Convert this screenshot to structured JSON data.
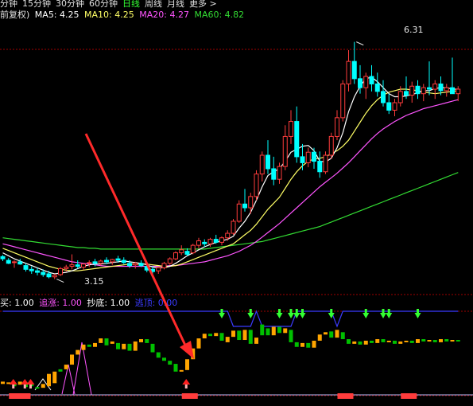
{
  "timeframes": [
    {
      "label": "分钟",
      "color": "#e0e0e0"
    },
    {
      "label": "15分钟",
      "color": "#e0e0e0"
    },
    {
      "label": "30分钟",
      "color": "#e0e0e0"
    },
    {
      "label": "60分钟",
      "color": "#e0e0e0"
    },
    {
      "label": "日线",
      "color": "#33ff33"
    },
    {
      "label": "周线",
      "color": "#e0e0e0"
    },
    {
      "label": "月线",
      "color": "#e0e0e0"
    },
    {
      "label": "更多 >",
      "color": "#e0e0e0"
    }
  ],
  "main_legend": {
    "prefix": "前复权)",
    "ma5": "MA5: 4.25",
    "ma10": "MA10: 4.25",
    "ma20": "MA20: 4.27",
    "ma60": "MA60: 4.82"
  },
  "colors": {
    "up": "#ff3c3c",
    "down": "#00ffff",
    "ma5": "#ffffff",
    "ma10": "#ffff66",
    "ma20": "#ff55ff",
    "ma60": "#33dd33",
    "indicator_line": "#3b3bff",
    "orange": "#ffa500",
    "green": "#00c000",
    "arrow_green": "#33ff33",
    "arrow_red": "#ff2020",
    "pink": "#ffb0b0",
    "gridline": "#a00000",
    "annotation_arrow": "#ff2a2a"
  },
  "sub_legend": {
    "buy": "买: 1.00",
    "chase": "追涨: 1.00",
    "bottom": "抄底: 1.00",
    "escape": "逃顶: 0.00"
  },
  "high_label": "6.31",
  "low_label": "3.15",
  "chart_data": {
    "type": "candlestick",
    "ohlc": [
      [
        3.45,
        3.47,
        3.39,
        3.42
      ],
      [
        3.4,
        3.43,
        3.35,
        3.36
      ],
      [
        3.37,
        3.4,
        3.3,
        3.38
      ],
      [
        3.38,
        3.42,
        3.34,
        3.35
      ],
      [
        3.33,
        3.36,
        3.25,
        3.28
      ],
      [
        3.28,
        3.32,
        3.22,
        3.26
      ],
      [
        3.26,
        3.3,
        3.2,
        3.24
      ],
      [
        3.24,
        3.28,
        3.18,
        3.21
      ],
      [
        3.22,
        3.26,
        3.16,
        3.18
      ],
      [
        3.18,
        3.22,
        3.15,
        3.2
      ],
      [
        3.21,
        3.31,
        3.19,
        3.29
      ],
      [
        3.29,
        3.34,
        3.25,
        3.31
      ],
      [
        3.32,
        3.48,
        3.28,
        3.34
      ],
      [
        3.34,
        3.4,
        3.29,
        3.32
      ],
      [
        3.31,
        3.36,
        3.27,
        3.35
      ],
      [
        3.36,
        3.4,
        3.31,
        3.37
      ],
      [
        3.38,
        3.42,
        3.32,
        3.36
      ],
      [
        3.36,
        3.41,
        3.33,
        3.39
      ],
      [
        3.4,
        3.44,
        3.35,
        3.38
      ],
      [
        3.38,
        3.42,
        3.34,
        3.41
      ],
      [
        3.42,
        3.46,
        3.37,
        3.4
      ],
      [
        3.4,
        3.44,
        3.35,
        3.37
      ],
      [
        3.36,
        3.4,
        3.3,
        3.33
      ],
      [
        3.34,
        3.38,
        3.29,
        3.36
      ],
      [
        3.36,
        3.4,
        3.31,
        3.33
      ],
      [
        3.32,
        3.36,
        3.24,
        3.27
      ],
      [
        3.28,
        3.32,
        3.22,
        3.25
      ],
      [
        3.26,
        3.31,
        3.22,
        3.3
      ],
      [
        3.3,
        3.38,
        3.28,
        3.36
      ],
      [
        3.36,
        3.44,
        3.34,
        3.42
      ],
      [
        3.42,
        3.52,
        3.4,
        3.5
      ],
      [
        3.5,
        3.6,
        3.47,
        3.54
      ],
      [
        3.52,
        3.56,
        3.46,
        3.48
      ],
      [
        3.5,
        3.62,
        3.48,
        3.6
      ],
      [
        3.6,
        3.7,
        3.56,
        3.66
      ],
      [
        3.64,
        3.68,
        3.58,
        3.62
      ],
      [
        3.62,
        3.7,
        3.58,
        3.68
      ],
      [
        3.68,
        3.74,
        3.62,
        3.64
      ],
      [
        3.64,
        3.72,
        3.6,
        3.7
      ],
      [
        3.7,
        3.8,
        3.66,
        3.76
      ],
      [
        3.76,
        3.95,
        3.74,
        3.92
      ],
      [
        3.92,
        4.2,
        3.9,
        4.15
      ],
      [
        4.15,
        4.35,
        4.05,
        4.1
      ],
      [
        4.1,
        4.3,
        4.02,
        4.25
      ],
      [
        4.25,
        4.6,
        4.2,
        4.55
      ],
      [
        4.55,
        4.85,
        4.45,
        4.8
      ],
      [
        4.8,
        5.0,
        4.55,
        4.62
      ],
      [
        4.62,
        4.78,
        4.4,
        4.48
      ],
      [
        4.48,
        4.7,
        4.42,
        4.65
      ],
      [
        4.65,
        5.2,
        4.6,
        5.05
      ],
      [
        5.05,
        5.4,
        4.95,
        5.25
      ],
      [
        5.25,
        5.45,
        4.7,
        4.78
      ],
      [
        4.78,
        4.95,
        4.6,
        4.7
      ],
      [
        4.7,
        4.9,
        4.64,
        4.84
      ],
      [
        4.84,
        4.9,
        4.62,
        4.72
      ],
      [
        4.72,
        4.85,
        4.5,
        4.58
      ],
      [
        4.58,
        4.85,
        4.55,
        4.8
      ],
      [
        4.8,
        5.1,
        4.75,
        5.05
      ],
      [
        5.05,
        5.4,
        5.0,
        5.3
      ],
      [
        5.3,
        5.8,
        5.25,
        5.75
      ],
      [
        5.75,
        6.2,
        5.65,
        6.05
      ],
      [
        6.05,
        6.31,
        5.75,
        5.82
      ],
      [
        5.82,
        6.0,
        5.62,
        5.7
      ],
      [
        5.7,
        5.9,
        5.55,
        5.85
      ],
      [
        5.85,
        6.0,
        5.65,
        5.75
      ],
      [
        5.75,
        5.9,
        5.58,
        5.65
      ],
      [
        5.65,
        5.8,
        5.45,
        5.5
      ],
      [
        5.5,
        5.62,
        5.35,
        5.4
      ],
      [
        5.4,
        5.55,
        5.32,
        5.5
      ],
      [
        5.5,
        5.72,
        5.45,
        5.65
      ],
      [
        5.65,
        5.85,
        5.55,
        5.6
      ],
      [
        5.6,
        5.78,
        5.5,
        5.72
      ],
      [
        5.72,
        5.8,
        5.55,
        5.62
      ],
      [
        5.62,
        5.75,
        5.52,
        5.7
      ],
      [
        5.7,
        6.05,
        5.6,
        5.68
      ],
      [
        5.68,
        5.8,
        5.55,
        5.75
      ],
      [
        5.75,
        5.85,
        5.6,
        5.66
      ],
      [
        5.66,
        5.75,
        5.58,
        5.7
      ],
      [
        5.7,
        6.1,
        5.62,
        5.62
      ],
      [
        5.62,
        5.72,
        5.52,
        5.68
      ]
    ],
    "ma5": [
      3.5,
      3.46,
      3.42,
      3.39,
      3.36,
      3.33,
      3.3,
      3.27,
      3.24,
      3.22,
      3.23,
      3.24,
      3.26,
      3.29,
      3.32,
      3.34,
      3.35,
      3.35,
      3.36,
      3.37,
      3.38,
      3.39,
      3.38,
      3.37,
      3.36,
      3.34,
      3.31,
      3.3,
      3.3,
      3.32,
      3.36,
      3.41,
      3.46,
      3.5,
      3.54,
      3.58,
      3.61,
      3.64,
      3.66,
      3.68,
      3.72,
      3.83,
      3.92,
      4.04,
      4.2,
      4.38,
      4.53,
      4.58,
      4.62,
      4.72,
      4.84,
      4.88,
      4.92,
      4.93,
      4.86,
      4.72,
      4.71,
      4.76,
      4.9,
      5.1,
      5.38,
      5.58,
      5.72,
      5.82,
      5.84,
      5.78,
      5.7,
      5.62,
      5.58,
      5.58,
      5.59,
      5.61,
      5.63,
      5.66,
      5.66,
      5.69,
      5.7,
      5.7,
      5.68,
      5.68
    ],
    "ma10": [
      3.56,
      3.53,
      3.5,
      3.47,
      3.44,
      3.41,
      3.38,
      3.35,
      3.32,
      3.3,
      3.28,
      3.27,
      3.26,
      3.26,
      3.27,
      3.28,
      3.29,
      3.3,
      3.31,
      3.32,
      3.33,
      3.34,
      3.35,
      3.35,
      3.35,
      3.35,
      3.34,
      3.33,
      3.32,
      3.32,
      3.33,
      3.35,
      3.38,
      3.41,
      3.44,
      3.47,
      3.5,
      3.53,
      3.56,
      3.59,
      3.62,
      3.68,
      3.74,
      3.8,
      3.88,
      3.98,
      4.08,
      4.16,
      4.24,
      4.36,
      4.48,
      4.58,
      4.66,
      4.72,
      4.75,
      4.76,
      4.78,
      4.82,
      4.86,
      4.92,
      5.0,
      5.12,
      5.24,
      5.36,
      5.46,
      5.54,
      5.6,
      5.64,
      5.66,
      5.68,
      5.68,
      5.67,
      5.66,
      5.64,
      5.63,
      5.62,
      5.63,
      5.64,
      5.65,
      5.66
    ],
    "ma20": [
      3.62,
      3.6,
      3.58,
      3.56,
      3.54,
      3.52,
      3.5,
      3.48,
      3.46,
      3.44,
      3.42,
      3.4,
      3.38,
      3.37,
      3.36,
      3.35,
      3.34,
      3.33,
      3.32,
      3.32,
      3.32,
      3.32,
      3.32,
      3.32,
      3.32,
      3.32,
      3.32,
      3.32,
      3.32,
      3.33,
      3.33,
      3.34,
      3.35,
      3.36,
      3.37,
      3.38,
      3.4,
      3.42,
      3.44,
      3.46,
      3.49,
      3.52,
      3.56,
      3.6,
      3.65,
      3.71,
      3.77,
      3.83,
      3.89,
      3.96,
      4.03,
      4.1,
      4.17,
      4.24,
      4.31,
      4.38,
      4.44,
      4.5,
      4.56,
      4.63,
      4.7,
      4.78,
      4.86,
      4.94,
      5.02,
      5.09,
      5.15,
      5.2,
      5.25,
      5.29,
      5.33,
      5.36,
      5.39,
      5.42,
      5.44,
      5.46,
      5.48,
      5.5,
      5.52,
      5.54
    ],
    "ma60": [
      3.7,
      3.69,
      3.68,
      3.67,
      3.66,
      3.65,
      3.64,
      3.63,
      3.62,
      3.61,
      3.6,
      3.59,
      3.58,
      3.57,
      3.57,
      3.56,
      3.56,
      3.55,
      3.55,
      3.55,
      3.55,
      3.55,
      3.55,
      3.55,
      3.55,
      3.55,
      3.55,
      3.55,
      3.55,
      3.55,
      3.55,
      3.55,
      3.55,
      3.55,
      3.55,
      3.55,
      3.56,
      3.57,
      3.58,
      3.59,
      3.6,
      3.61,
      3.62,
      3.63,
      3.64,
      3.65,
      3.67,
      3.69,
      3.71,
      3.73,
      3.75,
      3.77,
      3.79,
      3.81,
      3.83,
      3.85,
      3.88,
      3.91,
      3.94,
      3.97,
      4.0,
      4.03,
      4.06,
      4.09,
      4.12,
      4.15,
      4.18,
      4.21,
      4.24,
      4.27,
      4.3,
      4.33,
      4.36,
      4.39,
      4.42,
      4.45,
      4.48,
      4.51,
      4.54,
      4.57
    ],
    "ylim": [
      3.05,
      6.55
    ],
    "indicator_ylim": [
      0,
      10
    ],
    "indicator": [
      [
        1.0,
        1.3,
        "o"
      ],
      [
        1.0,
        1.2,
        "o"
      ],
      [
        0.7,
        1.1,
        "g"
      ],
      [
        0.9,
        1.3,
        "o"
      ],
      [
        1.2,
        0.6,
        "g"
      ],
      [
        1.0,
        0.7,
        "g"
      ],
      [
        0.6,
        0.4,
        "g"
      ],
      [
        0.5,
        1.0,
        "o"
      ],
      [
        0.7,
        2.3,
        "o"
      ],
      [
        1.1,
        2.6,
        "o"
      ],
      [
        2.6,
        2.9,
        "g"
      ],
      [
        2.9,
        3.5,
        "o"
      ],
      [
        3.5,
        4.8,
        "o"
      ],
      [
        4.8,
        5.4,
        "o"
      ],
      [
        5.4,
        6.1,
        "o"
      ],
      [
        6.1,
        5.8,
        "g"
      ],
      [
        5.8,
        6.3,
        "o"
      ],
      [
        6.3,
        6.9,
        "o"
      ],
      [
        6.9,
        6.0,
        "g"
      ],
      [
        6.2,
        6.5,
        "o"
      ],
      [
        6.3,
        5.5,
        "g"
      ],
      [
        5.5,
        6.2,
        "o"
      ],
      [
        6.2,
        5.3,
        "g"
      ],
      [
        5.3,
        6.5,
        "o"
      ],
      [
        6.4,
        6.8,
        "o"
      ],
      [
        6.8,
        6.3,
        "g"
      ],
      [
        6.2,
        5.1,
        "g"
      ],
      [
        5.1,
        4.4,
        "g"
      ],
      [
        4.4,
        4.0,
        "g"
      ],
      [
        4.0,
        3.5,
        "g"
      ],
      [
        3.6,
        2.6,
        "g"
      ],
      [
        2.6,
        2.8,
        "o"
      ],
      [
        2.8,
        4.2,
        "o"
      ],
      [
        4.2,
        5.6,
        "o"
      ],
      [
        5.6,
        6.9,
        "o"
      ],
      [
        6.9,
        7.5,
        "o"
      ],
      [
        7.5,
        7.2,
        "g"
      ],
      [
        7.2,
        7.6,
        "o"
      ],
      [
        7.6,
        6.6,
        "g"
      ],
      [
        6.4,
        7.1,
        "o"
      ],
      [
        7.1,
        7.9,
        "o"
      ],
      [
        7.9,
        6.7,
        "g"
      ],
      [
        6.7,
        8.0,
        "o"
      ],
      [
        8.0,
        6.2,
        "g"
      ],
      [
        6.2,
        7.0,
        "o"
      ],
      [
        7.3,
        8.7,
        "g"
      ],
      [
        8.2,
        7.3,
        "g"
      ],
      [
        7.3,
        8.4,
        "o"
      ],
      [
        8.4,
        7.6,
        "g"
      ],
      [
        7.6,
        8.2,
        "o"
      ],
      [
        8.0,
        6.4,
        "g"
      ],
      [
        6.4,
        5.8,
        "g"
      ],
      [
        5.8,
        6.3,
        "o"
      ],
      [
        6.3,
        5.7,
        "g"
      ],
      [
        5.7,
        6.6,
        "o"
      ],
      [
        6.6,
        7.4,
        "o"
      ],
      [
        7.4,
        7.7,
        "o"
      ],
      [
        7.8,
        7.0,
        "g"
      ],
      [
        7.0,
        8.0,
        "o"
      ],
      [
        7.7,
        6.8,
        "g"
      ],
      [
        6.8,
        6.2,
        "g"
      ],
      [
        6.2,
        6.5,
        "o"
      ],
      [
        6.5,
        6.1,
        "g"
      ],
      [
        6.1,
        6.6,
        "o"
      ],
      [
        6.6,
        6.3,
        "g"
      ],
      [
        6.3,
        6.8,
        "o"
      ],
      [
        6.8,
        6.4,
        "g"
      ],
      [
        6.4,
        6.6,
        "o"
      ],
      [
        6.6,
        6.2,
        "g"
      ],
      [
        6.2,
        6.5,
        "o"
      ],
      [
        6.5,
        6.6,
        "o"
      ],
      [
        6.6,
        6.3,
        "g"
      ],
      [
        6.3,
        6.8,
        "o"
      ],
      [
        6.8,
        6.5,
        "g"
      ],
      [
        6.5,
        6.7,
        "o"
      ],
      [
        6.7,
        6.4,
        "g"
      ],
      [
        6.4,
        6.8,
        "o"
      ],
      [
        6.8,
        6.5,
        "g"
      ],
      [
        6.5,
        6.7,
        "o"
      ],
      [
        6.7,
        6.5,
        "g"
      ]
    ],
    "green_arrow_indices": [
      38,
      43,
      48,
      50,
      51,
      52,
      57,
      63,
      66,
      67,
      72
    ],
    "red_arrow_indices": [
      1,
      3,
      4,
      31
    ],
    "red_block_indices": [
      1,
      2,
      31,
      58,
      69
    ]
  }
}
